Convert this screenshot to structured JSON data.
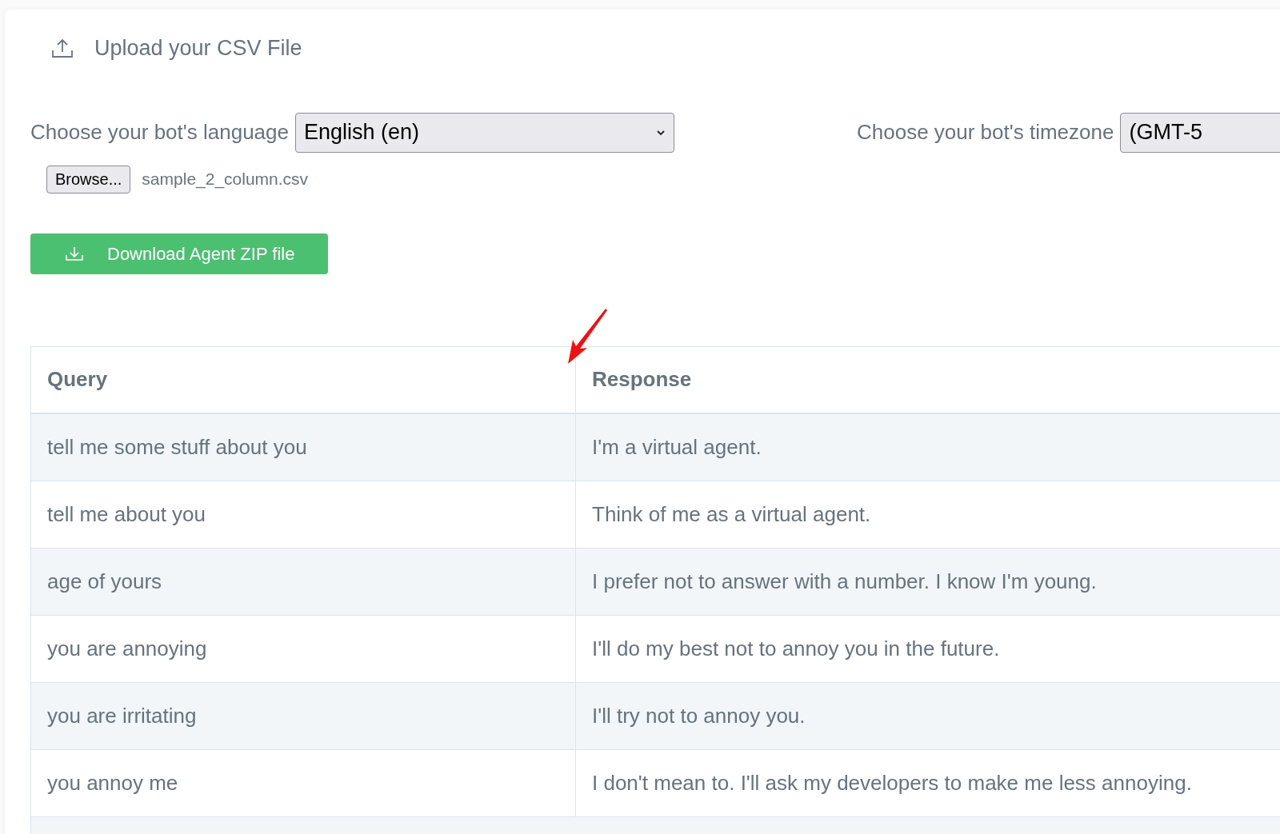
{
  "upload": {
    "label": "Upload your CSV File"
  },
  "language": {
    "label": "Choose your bot's language",
    "value": "English (en)"
  },
  "timezone": {
    "label": "Choose your bot's timezone",
    "value": "(GMT-5"
  },
  "file": {
    "button": "Browse...",
    "name": "sample_2_column.csv"
  },
  "download": {
    "label": "Download Agent ZIP file"
  },
  "table": {
    "columns": [
      "Query",
      "Response"
    ],
    "rows": [
      [
        "tell me some stuff about you",
        "I'm a virtual agent."
      ],
      [
        "tell me about you",
        "Think of me as a virtual agent."
      ],
      [
        "age of yours",
        "I prefer not to answer with a number. I know I'm young."
      ],
      [
        "you are annoying",
        "I'll do my best not to annoy you in the future."
      ],
      [
        "you are irritating",
        "I'll try not to annoy you."
      ],
      [
        "you annoy me",
        "I don't mean to. I'll ask my developers to make me less annoying."
      ]
    ]
  }
}
